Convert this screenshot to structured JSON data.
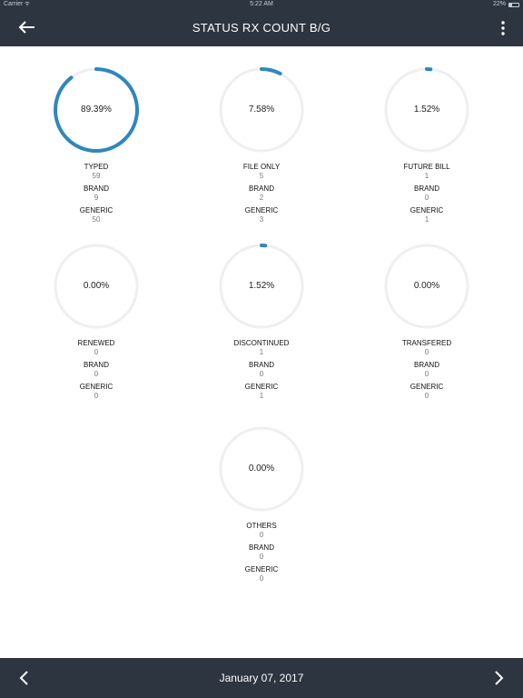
{
  "status_bar": {
    "carrier": "Carrier",
    "time": "5:22 AM",
    "battery": "22%"
  },
  "header": {
    "title": "STATUS RX COUNT B/G",
    "back_icon": "arrow-left-icon",
    "menu_icon": "more-vertical-icon"
  },
  "colors": {
    "bar": "#2c3540",
    "ring_track": "#eeeff1",
    "ring_progress": "#2f87bd"
  },
  "cells": [
    {
      "percent_value": 89.39,
      "percent": "89.39%",
      "status": "TYPED",
      "count": "59",
      "brand_label": "BRAND",
      "brand": "9",
      "generic_label": "GENERIC",
      "generic": "50"
    },
    {
      "percent_value": 7.58,
      "percent": "7.58%",
      "status": "FILE ONLY",
      "count": "5",
      "brand_label": "BRAND",
      "brand": "2",
      "generic_label": "GENERIC",
      "generic": "3"
    },
    {
      "percent_value": 1.52,
      "percent": "1.52%",
      "status": "FUTURE BILL",
      "count": "1",
      "brand_label": "BRAND",
      "brand": "0",
      "generic_label": "GENERIC",
      "generic": "1"
    },
    {
      "percent_value": 0,
      "percent": "0.00%",
      "status": "RENEWED",
      "count": "0",
      "brand_label": "BRAND",
      "brand": "0",
      "generic_label": "GENERIC",
      "generic": "0"
    },
    {
      "percent_value": 1.52,
      "percent": "1.52%",
      "status": "DISCONTINUED",
      "count": "1",
      "brand_label": "BRAND",
      "brand": "0",
      "generic_label": "GENERIC",
      "generic": "1"
    },
    {
      "percent_value": 0,
      "percent": "0.00%",
      "status": "TRANSFERED",
      "count": "0",
      "brand_label": "BRAND",
      "brand": "0",
      "generic_label": "GENERIC",
      "generic": "0"
    },
    {
      "percent_value": 0,
      "percent": "0.00%",
      "status": "OTHERS",
      "count": "0",
      "brand_label": "BRAND",
      "brand": "0",
      "generic_label": "GENERIC",
      "generic": "0"
    }
  ],
  "footer": {
    "date": "January 07, 2017",
    "prev_icon": "chevron-left-icon",
    "next_icon": "chevron-right-icon"
  }
}
